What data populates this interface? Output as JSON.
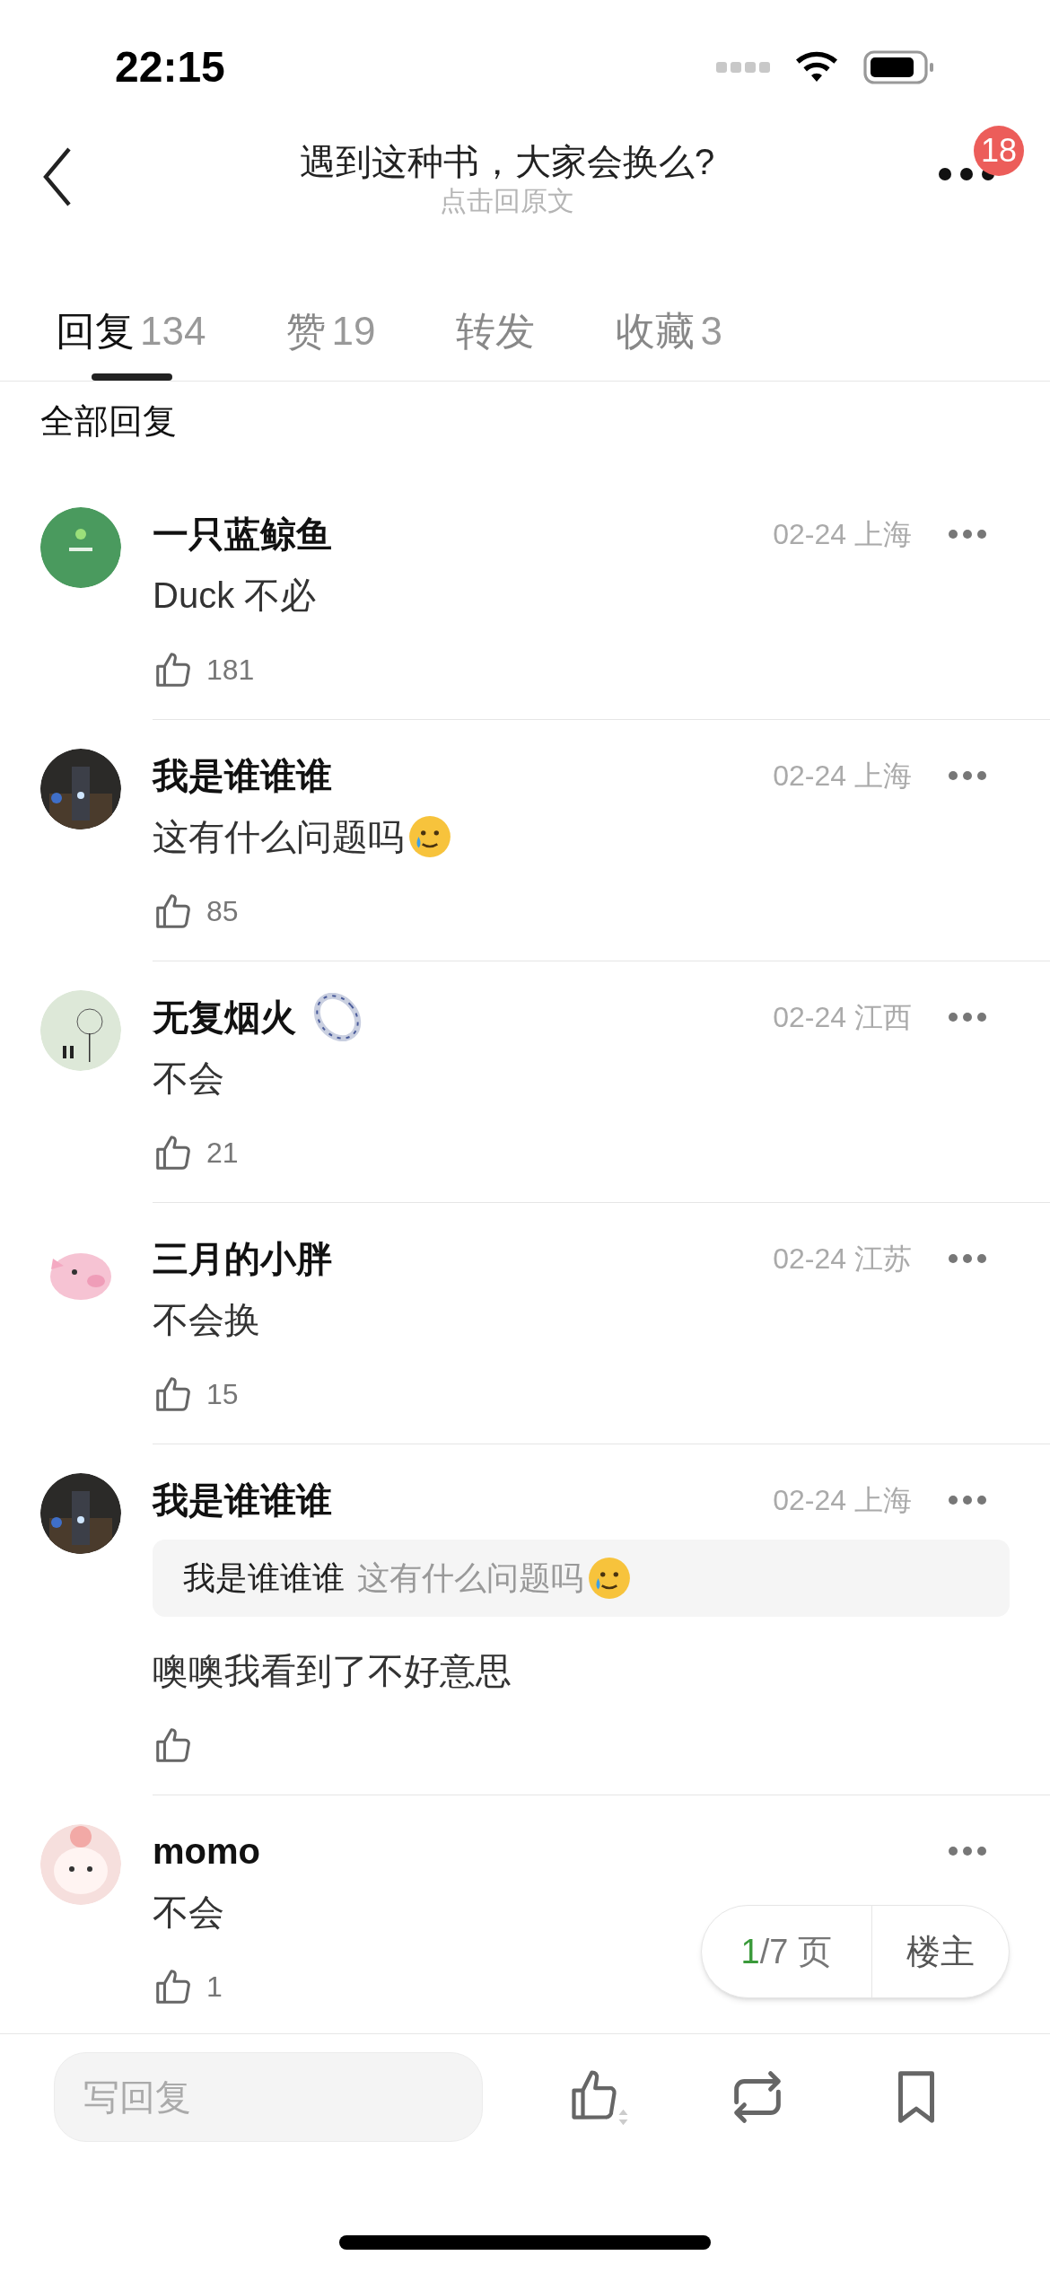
{
  "status_bar": {
    "time": "22:15"
  },
  "nav": {
    "title": "遇到这种书，大家会换么?",
    "subtitle": "点击回原文",
    "badge": "18"
  },
  "tabs": [
    {
      "label": "回复",
      "count": "134",
      "selected": true
    },
    {
      "label": "赞",
      "count": "19",
      "selected": false
    },
    {
      "label": "转发",
      "selected": false
    },
    {
      "label": "收藏",
      "count": "3",
      "selected": false
    }
  ],
  "section_title": "全部回复",
  "comments": [
    {
      "name": "一只蓝鲸鱼",
      "date": "02-24 上海",
      "text": "Duck 不必",
      "likes": "181"
    },
    {
      "name": "我是谁谁谁",
      "date": "02-24 上海",
      "text": "这有什么问题吗",
      "emoji": true,
      "likes": "85"
    },
    {
      "name": "无复烟火",
      "ring_badge": true,
      "date": "02-24 江西",
      "text": "不会",
      "likes": "21"
    },
    {
      "name": "三月的小胖",
      "date": "02-24 江苏",
      "text": "不会换",
      "likes": "15"
    },
    {
      "name": "我是谁谁谁",
      "date": "02-24 上海",
      "quote": {
        "author": "我是谁谁谁",
        "text": "这有什么问题吗",
        "emoji": true
      },
      "text": "噢噢我看到了不好意思"
    },
    {
      "name": "momo",
      "text": "不会",
      "likes": "1"
    }
  ],
  "pager": {
    "current": "1",
    "total": "/7 页",
    "owner_button": "楼主"
  },
  "bottom_bar": {
    "placeholder": "写回复"
  }
}
